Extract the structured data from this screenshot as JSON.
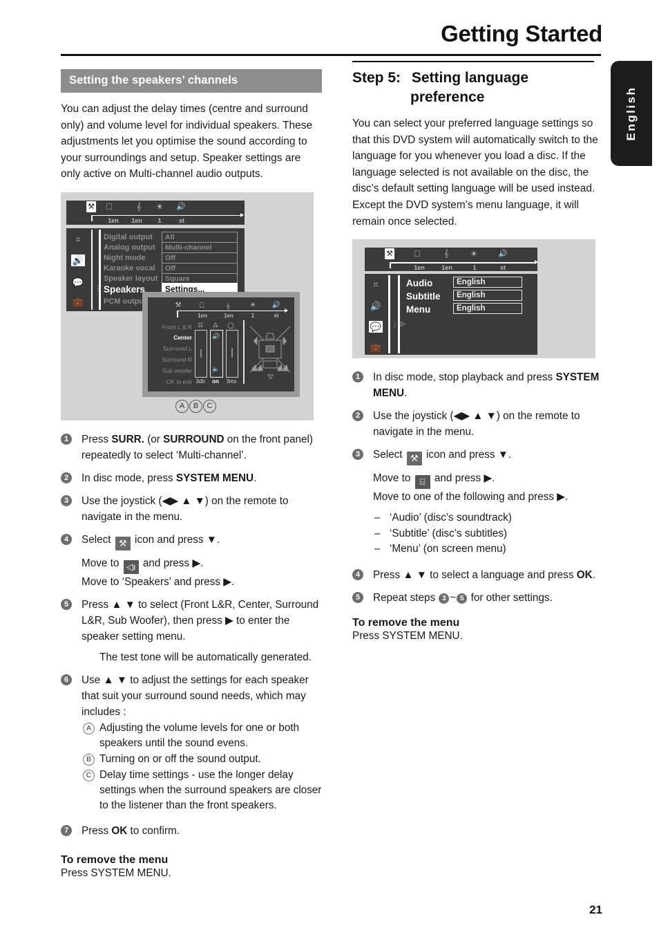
{
  "header": {
    "title": "Getting Started",
    "lang_tab": "English",
    "page_number": "21"
  },
  "left": {
    "section_title": "Setting the speakers’ channels",
    "intro": "You can adjust the delay times (centre and surround only) and volume level for individual speakers.  These adjustments let you optimise the sound according to your surroundings and setup.  Speaker settings are only active on Multi-channel audio outputs.",
    "figure": {
      "topbar": {
        "icons": [
          "tools-icon",
          "display-icon",
          "language-icon",
          "disc-icon",
          "speaker-icon"
        ],
        "labels": [
          "1en",
          "1en",
          "1",
          "st"
        ],
        "selected_icon": "tools-icon"
      },
      "rail_icons": [
        "disc-page-icon",
        "speaker-icon",
        "subtitle-icon",
        "briefcase-icon"
      ],
      "rail_selected": "speaker-icon",
      "menu": [
        {
          "label": "Digital output",
          "value": "All",
          "selected": false
        },
        {
          "label": "Analog output",
          "value": "Multi-channel",
          "selected": false
        },
        {
          "label": "Night mode",
          "value": "Off",
          "selected": false
        },
        {
          "label": "Karaoke vocal",
          "value": "Off",
          "selected": false
        },
        {
          "label": "Speaker layout",
          "value": "Square",
          "selected": false
        },
        {
          "label": "Speakers",
          "value": "Settings...",
          "selected": true
        },
        {
          "label": "PCM output",
          "value": "",
          "selected": false
        }
      ],
      "speaker_dialog": {
        "topbar_labels": [
          "1en",
          "1en",
          "1",
          "st"
        ],
        "speakers": [
          "Front L & R",
          "Center",
          "Surround L",
          "Surround R",
          "Sub woofer",
          "OK to exit"
        ],
        "selected_speaker": "Center",
        "meter_headers": [
          "level-icon",
          "speaker-icon",
          "delay-icon"
        ],
        "values": [
          "3db",
          "on",
          "3ms"
        ],
        "selected_value": "on"
      },
      "markers": [
        "A",
        "B",
        "C"
      ]
    },
    "steps": [
      {
        "n": "1",
        "lines": [
          {
            "type": "rich",
            "html": "Press <b class=\"k\">SURR.</b> (or <b class=\"k\">SURROUND</b> on the front panel) repeatedly to select ‘Multi-channel’."
          }
        ]
      },
      {
        "n": "2",
        "lines": [
          {
            "type": "rich",
            "html": "In disc mode, press <b class=\"k\">SYSTEM MENU</b>."
          }
        ]
      },
      {
        "n": "3",
        "lines": [
          {
            "type": "rich",
            "html": "Use the joystick (◀▶ ▲ ▼) on the remote to navigate in the menu."
          }
        ]
      },
      {
        "n": "4",
        "lines": [
          {
            "type": "rich",
            "html": "Select <span class=\"ic tool\" data-name=\"tools-icon\">⚒</span> icon and press ▼."
          },
          {
            "type": "rich",
            "html": "Move to <span class=\"ic spk\" data-name=\"speaker-icon\">◁ı</span> and press ▶.<br>Move to ‘Speakers’ and press ▶."
          }
        ]
      },
      {
        "n": "5",
        "lines": [
          {
            "type": "rich",
            "html": "Press ▲ ▼ to select (Front L&amp;R, Center, Surround L&amp;R, Sub Woofer), then press ▶ to enter the speaker setting menu."
          },
          {
            "type": "indent",
            "html": "The test tone will be automatically generated."
          }
        ]
      },
      {
        "n": "6",
        "lines": [
          {
            "type": "rich",
            "html": "Use ▲ ▼ to adjust the settings for each speaker that suit your surround sound needs, which may includes :"
          }
        ],
        "sub": [
          {
            "mark": "A",
            "text": "Adjusting the volume levels for one or both speakers until the sound evens."
          },
          {
            "mark": "B",
            "text": "Turning on or off the sound output."
          },
          {
            "mark": "C",
            "text": "Delay time settings - use the longer delay settings when the surround speakers are closer to the listener than the front speakers."
          }
        ]
      },
      {
        "n": "7",
        "lines": [
          {
            "type": "rich",
            "html": "Press <b class=\"k\">OK</b> to confirm."
          }
        ]
      }
    ],
    "remove_head": "To remove the menu",
    "remove_sub": "Press SYSTEM MENU."
  },
  "right": {
    "step_label": "Step 5:",
    "step_title_line1": "Setting language",
    "step_title_line2": "preference",
    "intro": "You can select your preferred language settings so that this DVD system will automatically switch to the language for you whenever you load a disc.  If the language selected is not available on the disc, the disc’s default setting language will be used instead.  Except the DVD system’s menu language, it will remain once selected.",
    "figure": {
      "topbar": {
        "icons": [
          "tools-icon",
          "display-icon",
          "language-icon",
          "disc-icon",
          "speaker-icon"
        ],
        "labels": [
          "1en",
          "1en",
          "1",
          "st"
        ],
        "selected_icon": "tools-icon"
      },
      "rail_icons": [
        "disc-page-icon",
        "speaker-icon",
        "subtitle-icon",
        "briefcase-icon"
      ],
      "rail_selected": "subtitle-icon",
      "menu": [
        {
          "label": "Audio",
          "value": "English"
        },
        {
          "label": "Subtitle",
          "value": "English"
        },
        {
          "label": "Menu",
          "value": "English"
        }
      ]
    },
    "steps": [
      {
        "n": "1",
        "lines": [
          {
            "type": "rich",
            "html": "In disc mode, stop playback and press <b class=\"k\">SYSTEM MENU</b>."
          }
        ]
      },
      {
        "n": "2",
        "lines": [
          {
            "type": "rich",
            "html": "Use the joystick (◀▶ ▲ ▼) on the remote to navigate in the menu."
          }
        ]
      },
      {
        "n": "3",
        "lines": [
          {
            "type": "rich",
            "html": "Select <span class=\"ic tool\" data-name=\"tools-icon\">⚒</span> icon and press ▼."
          },
          {
            "type": "rich",
            "html": "Move to <span class=\"ic sub2\" data-name=\"subtitle-icon\">⌸</span> and press ▶.<br>Move to one of the following and press ▶."
          }
        ],
        "dashes": [
          "‘Audio’ (disc’s soundtrack)",
          "‘Subtitle’ (disc’s subtitles)",
          "‘Menu’ (on screen menu)"
        ]
      },
      {
        "n": "4",
        "lines": [
          {
            "type": "rich",
            "html": "Press ▲ ▼ to select a language and press <b class=\"k\">OK</b>."
          }
        ]
      },
      {
        "n": "5",
        "lines": [
          {
            "type": "rich",
            "html": "Repeat steps <span class=\"numinline\">3</span>~<span class=\"numinline\">5</span> for other settings."
          }
        ]
      }
    ],
    "remove_head": "To remove the menu",
    "remove_sub": "Press SYSTEM MENU."
  }
}
